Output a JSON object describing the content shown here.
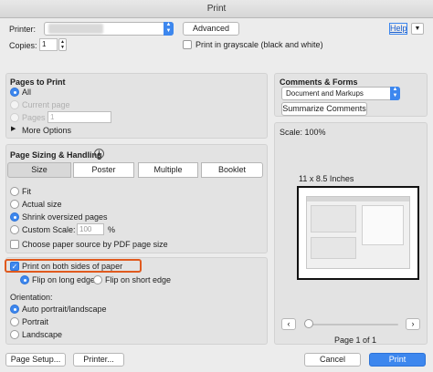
{
  "window": {
    "title": "Print"
  },
  "top": {
    "printer_label": "Printer:",
    "printer_value": "",
    "advanced_label": "Advanced",
    "help_label": "Help",
    "copies_label": "Copies:",
    "copies_value": "1",
    "grayscale_label": "Print in grayscale (black and white)"
  },
  "pages_to_print": {
    "title": "Pages to Print",
    "options": [
      "All",
      "Current page",
      "Pages"
    ],
    "pages_value": "1",
    "more_options_label": "More Options"
  },
  "sizing": {
    "title": "Page Sizing & Handling",
    "info_icon": "info-icon",
    "tabs": [
      "Size",
      "Poster",
      "Multiple",
      "Booklet"
    ],
    "fit_label": "Fit",
    "actual_size_label": "Actual size",
    "shrink_label": "Shrink oversized pages",
    "custom_scale_label": "Custom Scale:",
    "custom_scale_value": "100",
    "percent_sign": "%",
    "paper_source_label": "Choose paper source by PDF page size"
  },
  "duplex": {
    "both_sides_label": "Print on both sides of paper",
    "long_edge_label": "Flip on long edge",
    "short_edge_label": "Flip on short edge",
    "highlight_color": "#e05a1e"
  },
  "orientation": {
    "title": "Orientation:",
    "options": [
      "Auto portrait/landscape",
      "Portrait",
      "Landscape"
    ]
  },
  "comments": {
    "title": "Comments & Forms",
    "select_value": "Document and Markups",
    "summarize_label": "Summarize Comments"
  },
  "preview": {
    "scale_label": "Scale: 100%",
    "paper_label": "11 x 8.5 Inches",
    "page_indicator": "Page 1 of 1",
    "prev_icon": "chevron-left-icon",
    "next_icon": "chevron-right-icon"
  },
  "bottom": {
    "page_setup_label": "Page Setup...",
    "printer_button_label": "Printer...",
    "cancel_label": "Cancel",
    "print_label": "Print"
  },
  "colors": {
    "accent": "#3d87ee",
    "highlight": "#e05a1e"
  }
}
